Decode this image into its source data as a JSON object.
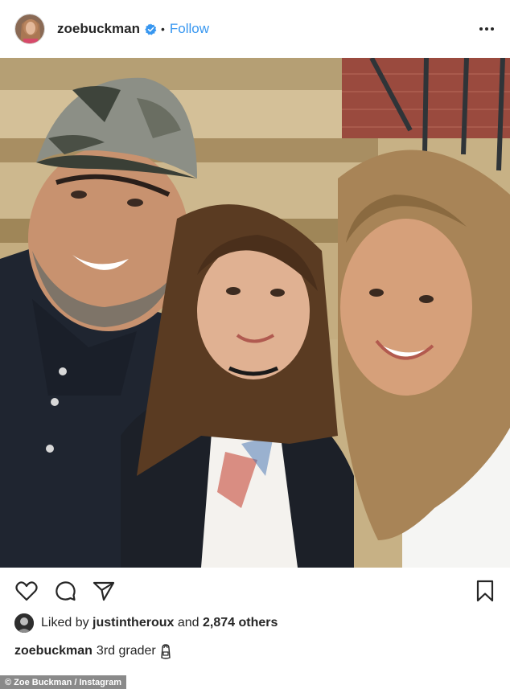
{
  "header": {
    "username": "zoebuckman",
    "separator": "•",
    "follow_label": "Follow",
    "avatar_icon": "profile-avatar",
    "verified_icon": "verified-badge-icon",
    "more_icon": "more-options-icon"
  },
  "actions": {
    "like_icon": "heart-icon",
    "comment_icon": "comment-icon",
    "share_icon": "share-icon",
    "save_icon": "bookmark-icon"
  },
  "likes": {
    "prefix": "Liked by",
    "liker": "justintheroux",
    "conjunction": "and",
    "count": "2,874 others"
  },
  "caption": {
    "username": "zoebuckman",
    "text": "3rd grader",
    "emoji": "backpack-emoji"
  },
  "credit": "© Zoe Buckman / Instagram",
  "colors": {
    "link": "#3897f0",
    "text": "#262626",
    "verified": "#3897f0",
    "credit_bg": "#8a8a8a"
  }
}
